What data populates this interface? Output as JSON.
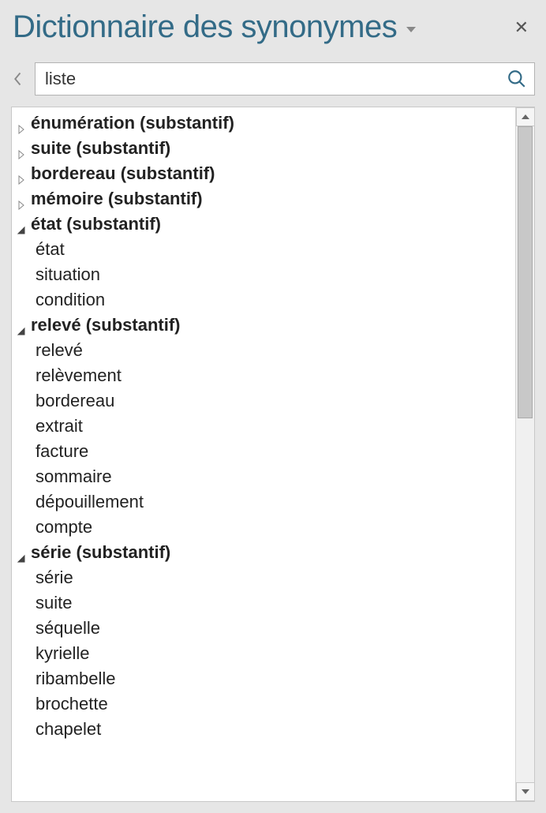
{
  "panel": {
    "title": "Dictionnaire des synonymes",
    "search_value": "liste"
  },
  "results": [
    {
      "type": "group",
      "expanded": false,
      "label": "énumération (substantif)"
    },
    {
      "type": "group",
      "expanded": false,
      "label": "suite (substantif)"
    },
    {
      "type": "group",
      "expanded": false,
      "label": "bordereau (substantif)"
    },
    {
      "type": "group",
      "expanded": false,
      "label": "mémoire (substantif)"
    },
    {
      "type": "group",
      "expanded": true,
      "label": "état (substantif)",
      "items": [
        "état",
        "situation",
        "condition"
      ]
    },
    {
      "type": "group",
      "expanded": true,
      "label": "relevé (substantif)",
      "items": [
        "relevé",
        "relèvement",
        "bordereau",
        "extrait",
        "facture",
        "sommaire",
        "dépouillement",
        "compte"
      ]
    },
    {
      "type": "group",
      "expanded": true,
      "label": "série (substantif)",
      "items": [
        "série",
        "suite",
        "séquelle",
        "kyrielle",
        "ribambelle",
        "brochette",
        "chapelet"
      ]
    }
  ]
}
